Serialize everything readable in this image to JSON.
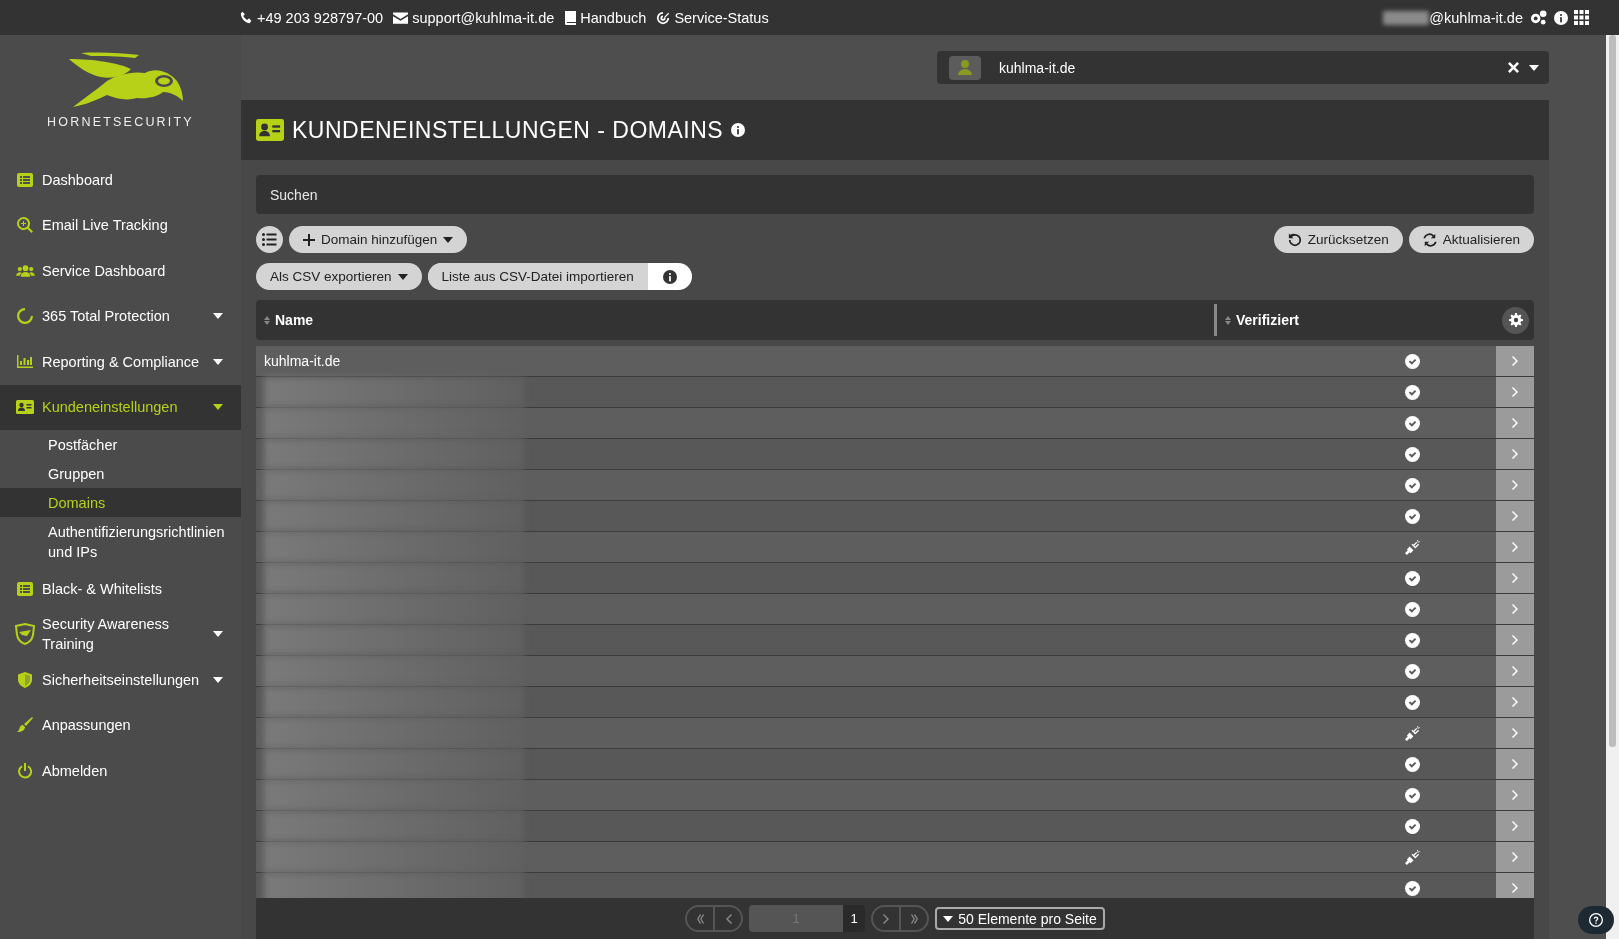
{
  "topbar": {
    "phone": "+49 203 928797-00",
    "email": "support@kuhlma-it.de",
    "manual": "Handbuch",
    "status": "Service-Status",
    "user": "@kuhlma-it.de"
  },
  "logo": {
    "text": "HORNETSECURITY"
  },
  "sidebar": {
    "items": [
      {
        "label": "Dashboard",
        "expandable": false,
        "selected": false
      },
      {
        "label": "Email Live Tracking",
        "expandable": false,
        "selected": false
      },
      {
        "label": "Service Dashboard",
        "expandable": false,
        "selected": false
      },
      {
        "label": "365 Total Protection",
        "expandable": true,
        "selected": false
      },
      {
        "label": "Reporting & Compliance",
        "expandable": true,
        "selected": false
      },
      {
        "label": "Kundeneinstellungen",
        "expandable": true,
        "selected": true,
        "children": [
          {
            "label": "Postfächer",
            "selected": false
          },
          {
            "label": "Gruppen",
            "selected": false
          },
          {
            "label": "Domains",
            "selected": true
          },
          {
            "label": "Authentifizierungsrichtlinien und IPs",
            "selected": false
          }
        ]
      },
      {
        "label": "Black- & Whitelists",
        "expandable": false,
        "selected": false
      },
      {
        "label": "Security Awareness Training",
        "expandable": true,
        "selected": false
      },
      {
        "label": "Sicherheitseinstellungen",
        "expandable": true,
        "selected": false
      },
      {
        "label": "Anpassungen",
        "expandable": false,
        "selected": false
      },
      {
        "label": "Abmelden",
        "expandable": false,
        "selected": false
      }
    ]
  },
  "customer_selector": {
    "value": "kuhlma-it.de"
  },
  "page": {
    "title": "KUNDENEINSTELLUNGEN - DOMAINS"
  },
  "search": {
    "placeholder": "Suchen"
  },
  "toolbar": {
    "add": "Domain hinzufügen",
    "reset": "Zurücksetzen",
    "refresh": "Aktualisieren",
    "export": "Als CSV exportieren",
    "import": "Liste aus CSV-Datei importieren"
  },
  "table": {
    "columns": [
      "Name",
      "Verifiziert"
    ],
    "rows": [
      {
        "name": "kuhlma-it.de",
        "verified": true
      },
      {
        "redacted": true,
        "verified": true
      },
      {
        "redacted": true,
        "verified": true
      },
      {
        "redacted": true,
        "verified": true
      },
      {
        "redacted": true,
        "verified": true
      },
      {
        "redacted": true,
        "verified": true
      },
      {
        "redacted": true,
        "verified": false
      },
      {
        "redacted": true,
        "verified": true
      },
      {
        "redacted": true,
        "verified": true
      },
      {
        "redacted": true,
        "verified": true
      },
      {
        "redacted": true,
        "verified": true
      },
      {
        "redacted": true,
        "verified": true
      },
      {
        "redacted": true,
        "verified": false
      },
      {
        "redacted": true,
        "verified": true
      },
      {
        "redacted": true,
        "verified": true
      },
      {
        "redacted": true,
        "verified": true
      },
      {
        "redacted": true,
        "verified": false
      },
      {
        "redacted": true,
        "verified": true
      }
    ]
  },
  "pagination": {
    "page_placeholder": "1",
    "page_count": "1",
    "page_size": "50 Elemente pro Seite"
  }
}
